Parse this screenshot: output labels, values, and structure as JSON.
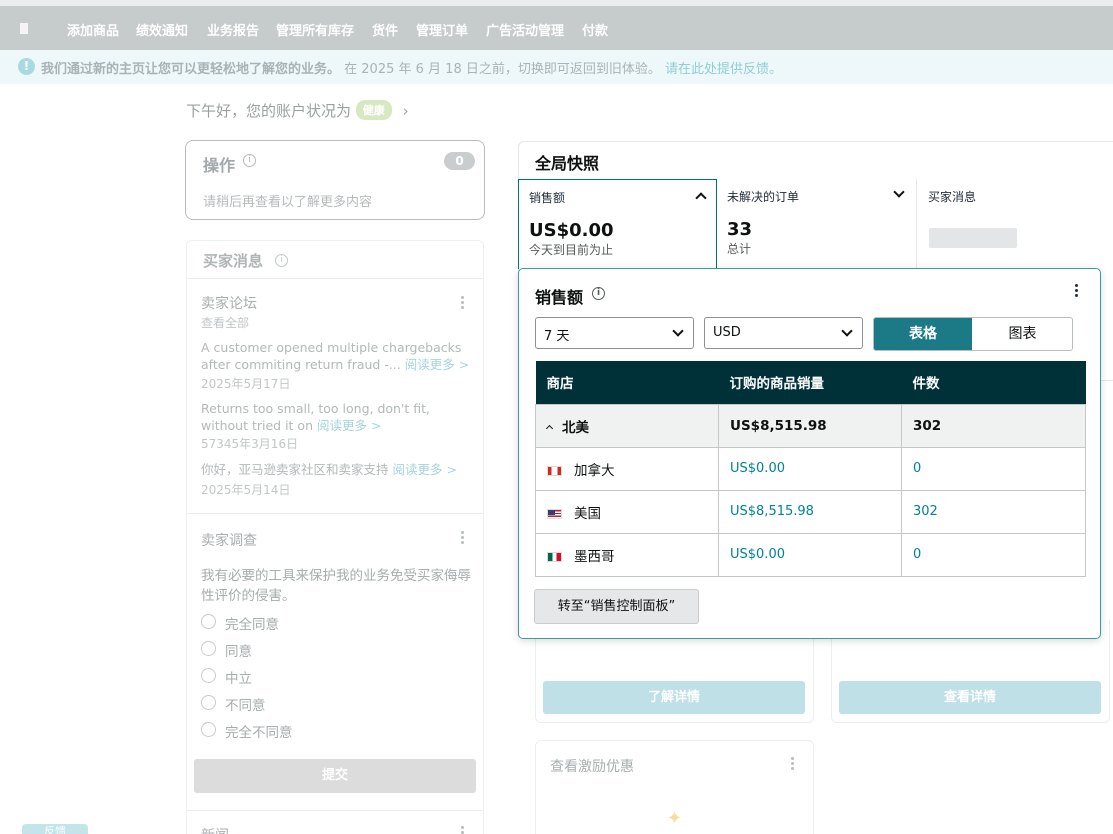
{
  "nav": {
    "items": [
      "添加商品",
      "绩效通知",
      "业务报告",
      "管理所有库存",
      "货件",
      "管理订单",
      "广告活动管理",
      "付款"
    ]
  },
  "banner": {
    "bold_text": "我们通过新的主页让您可以更轻松地了解您的业务。",
    "text": "在 2025 年 6 月 18 日之前，切换即可返回到旧体验。",
    "link": "请在此处提供反馈。"
  },
  "greeting": {
    "text": "下午好，您的账户状况为",
    "status": "健康",
    "chevron": "›"
  },
  "actions": {
    "title": "操作",
    "count": "0",
    "message": "请稍后再查看以了解更多内容"
  },
  "buyer_messages": {
    "title": "买家消息"
  },
  "forum": {
    "title": "卖家论坛",
    "view_all": "查看全部",
    "posts": [
      {
        "text": "A customer opened multiple chargebacks after commiting return fraud -...",
        "link": "阅读更多 >",
        "date": "2025年5月17日"
      },
      {
        "text": "Returns too small, too long, don't fit, without tried it on",
        "link": "阅读更多 >",
        "date": "57345年3月16日"
      },
      {
        "text": "你好，亚马逊卖家社区和卖家支持",
        "link": "阅读更多 >",
        "date": "2025年5月14日"
      }
    ]
  },
  "survey": {
    "title": "卖家调查",
    "question": "我有必要的工具来保护我的业务免受买家侮辱性评价的侵害。",
    "options": [
      "完全同意",
      "同意",
      "中立",
      "不同意",
      "完全不同意"
    ],
    "submit": "提交"
  },
  "news": {
    "title": "新闻"
  },
  "feedback_tab": "反馈",
  "snapshot": {
    "title": "全局快照",
    "tiles": [
      {
        "label": "销售额",
        "value": "US$0.00",
        "caption": "今天到目前为止"
      },
      {
        "label": "未解决的订单",
        "value": "33",
        "caption": "总计"
      },
      {
        "label": "买家消息"
      }
    ]
  },
  "cards": {
    "learn_more": "了解详情",
    "view_details": "查看详情",
    "incentives_title": "查看激励优惠"
  },
  "sales_popup": {
    "title": "销售额",
    "period": "7 天",
    "currency": "USD",
    "view_table": "表格",
    "view_chart": "图表",
    "columns": [
      "商店",
      "订购的商品销量",
      "件数"
    ],
    "rows": [
      {
        "store": "北美",
        "sales": "US$8,515.98",
        "units": "302",
        "group": true
      },
      {
        "store": "加拿大",
        "sales": "US$0.00",
        "units": "0",
        "flag": "ca-flag-icon"
      },
      {
        "store": "美国",
        "sales": "US$8,515.98",
        "units": "302",
        "flag": "us-flag-icon"
      },
      {
        "store": "墨西哥",
        "sales": "US$0.00",
        "units": "0",
        "flag": "mx-flag-icon"
      }
    ],
    "go_button": "转至“销售控制面板”"
  },
  "colors": {
    "accent": "#007185",
    "header_bg": "#003038",
    "nav_bg": "#c6cbcb"
  }
}
